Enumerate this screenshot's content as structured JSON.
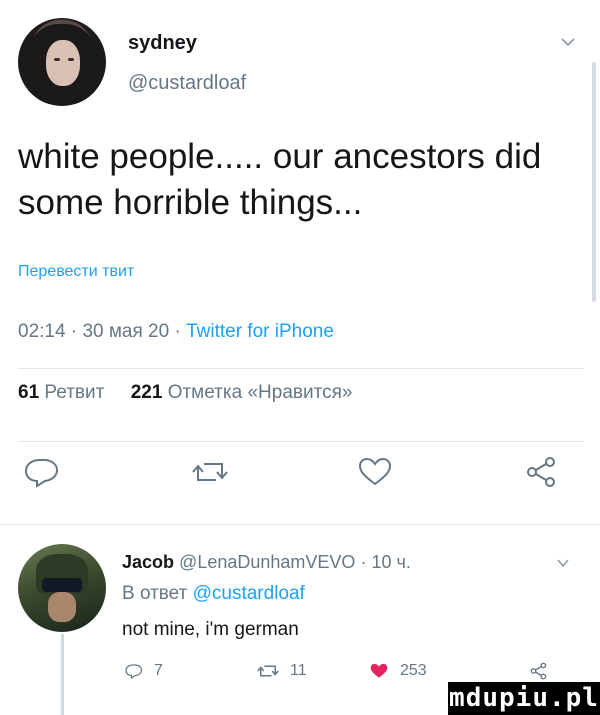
{
  "tweet": {
    "author_name": "sydney",
    "author_handle": "@custardloaf",
    "text": "white people..... our ancestors did some horrible things...",
    "translate_link": "Перевести твит",
    "time": "02:14",
    "date": "30 мая 20",
    "source": "Twitter for iPhone",
    "retweets_count": "61",
    "retweets_label": "Ретвит",
    "likes_count": "221",
    "likes_label": "Отметка «Нравится»"
  },
  "reply": {
    "author_name": "Jacob",
    "author_handle": "@LenaDunhamVEVO",
    "time_ago": "10 ч.",
    "reply_prefix": "В ответ",
    "reply_to": "@custardloaf",
    "text": "not mine, i'm german",
    "reply_count": "7",
    "retweet_count": "11",
    "like_count": "253"
  },
  "watermark": "mdupiu.pl",
  "colors": {
    "accent": "#1da1f2",
    "muted": "#657786",
    "like": "#e0245e",
    "text": "#14171a"
  },
  "icons": [
    "chevron-down-icon",
    "reply-icon",
    "retweet-icon",
    "like-icon",
    "share-icon"
  ]
}
